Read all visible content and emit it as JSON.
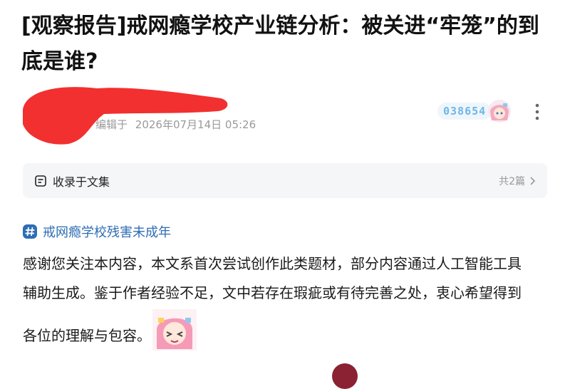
{
  "article": {
    "title": "[观察报告]戒网瘾学校产业链分析：被关进“牢笼”的到底是谁?",
    "edited_label": "编辑于",
    "edited_time": "2026年07月14日 05:26"
  },
  "badge": {
    "number": "038654",
    "avatar_icon": "anime-avatar-icon"
  },
  "collection": {
    "icon": "collection-book-icon",
    "label": "收录于文集",
    "count": "共2篇",
    "chevron_icon": "chevron-right-icon"
  },
  "topic": {
    "icon": "hashtag-icon",
    "label": "戒网瘾学校残害未成年"
  },
  "content": {
    "line1": "感谢您关注本内容，本文系首次尝试创作此类题材，部分内容通过人工智能工具",
    "line2": "辅助生成。鉴于作者经验不足，文中若存在瑕疵或有待完善之处，衷心希望得到",
    "line3": "各位的理解与包容。",
    "sticker_icon": "anime-sticker-icon"
  },
  "colors": {
    "redaction": "#f2302f",
    "link": "#2e6db4",
    "collection_bg": "#f5f6f8",
    "badge_number": "#6fb7e6"
  }
}
